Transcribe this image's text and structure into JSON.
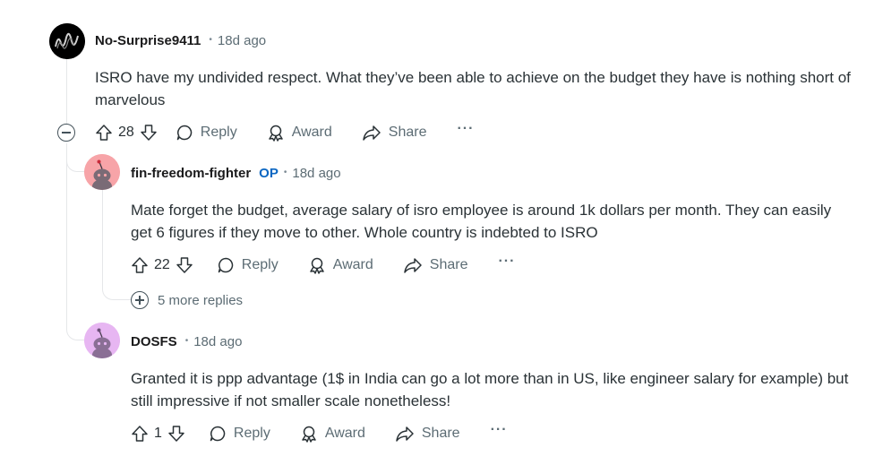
{
  "comments": [
    {
      "author": "No-Surprise9411",
      "op_badge": "",
      "separator": "•",
      "time": "18d ago",
      "body": "ISRO have my undivided respect. What they’ve been able to achieve on the budget they have is nothing short of marvelous",
      "votes": "28",
      "reply_label": "Reply",
      "award_label": "Award",
      "share_label": "Share",
      "more_label": "···",
      "avatar_icon": "squiggle-avatar-icon",
      "avatar_color": "#000000"
    },
    {
      "author": "fin-freedom-fighter",
      "op_badge": "OP",
      "separator": "•",
      "time": "18d ago",
      "body": "Mate forget the budget, average salary of isro employee is around 1k dollars per month. They can easily get 6 figures if they move to other. Whole country is indebted to ISRO",
      "votes": "22",
      "reply_label": "Reply",
      "award_label": "Award",
      "share_label": "Share",
      "more_label": "···",
      "avatar_icon": "snoo-avatar-icon",
      "avatar_color": "#f7a4a8"
    },
    {
      "author": "DOSFS",
      "op_badge": "",
      "separator": "•",
      "time": "18d ago",
      "body": "Granted it is ppp advantage (1$ in India can go a lot more than in US, like engineer salary for example) but still impressive if not smaller scale nonetheless!",
      "votes": "1",
      "reply_label": "Reply",
      "award_label": "Award",
      "share_label": "Share",
      "more_label": "···",
      "avatar_icon": "snoo-avatar-icon",
      "avatar_color": "#e7b6f2"
    }
  ],
  "more_replies_label": "5 more replies",
  "colors": {
    "op": "#0a66c2",
    "meta": "#5c6c74",
    "thread_line": "#e5e7e9"
  }
}
